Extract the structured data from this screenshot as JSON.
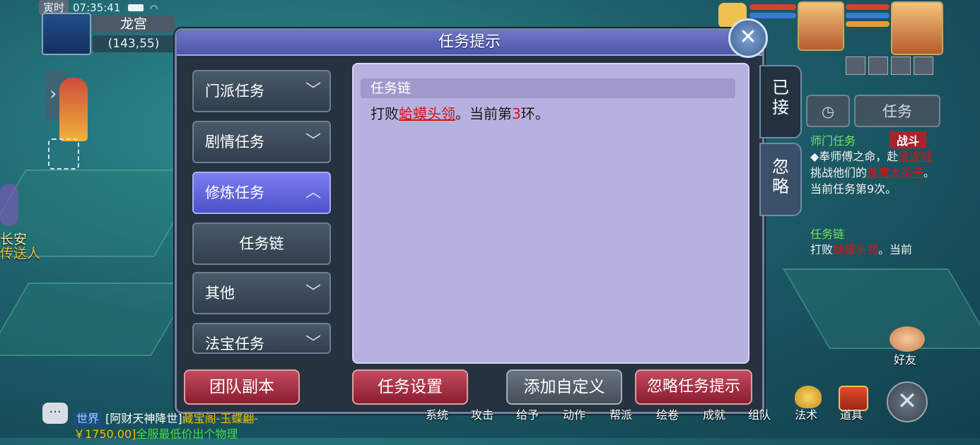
{
  "status": {
    "tag": "寅时",
    "time": "07:35:41"
  },
  "map": {
    "name": "龙宫",
    "coords": "(143,55)"
  },
  "left_npcs": [
    {
      "label": "长安"
    },
    {
      "label": "传送人"
    }
  ],
  "dialog": {
    "title": "任务提示",
    "categories": [
      {
        "label": "门派任务",
        "expanded": false
      },
      {
        "label": "剧情任务",
        "expanded": false
      },
      {
        "label": "修炼任务",
        "expanded": true,
        "active": true
      },
      {
        "label": "任务链",
        "sub": true
      },
      {
        "label": "其他",
        "expanded": false
      },
      {
        "label": "法宝任务",
        "expanded": false
      }
    ],
    "detail": {
      "header": "任务链",
      "prefix": "打败",
      "target": "蛤蟆头领",
      "middle": "。当前第",
      "count": "3",
      "suffix": "环。"
    },
    "tabs": [
      {
        "label": "已接",
        "active": true
      },
      {
        "label": "忽略",
        "active": false
      }
    ],
    "buttons": {
      "team_dungeon": "团队副本",
      "task_settings": "任务设置",
      "add_custom": "添加自定义",
      "ignore_tips": "忽略任务提示"
    }
  },
  "tracker": {
    "tab_label": "任务",
    "item1": {
      "title": "师门任务",
      "tag": "战斗",
      "line1": "◆奉师傅之命，赴",
      "link1": "凌波城",
      "line2": "挑战他们的",
      "link2": "首席大弟子",
      "line3": "。当前任务第9次。"
    },
    "item2": {
      "title": "任务链",
      "prefix": "打败",
      "link": "蛤蟆头领",
      "suffix": "。当前"
    }
  },
  "chat": {
    "channel": "世界",
    "sender": "[阿财天神降世]",
    "msg1": "藏宝阁-玉蝶翩-￥1750.00]",
    "msg2": "全服最低价出个物理"
  },
  "bottom_menu": [
    "系统",
    "攻击",
    "给予",
    "动作",
    "帮派",
    "绘卷",
    "成就",
    "组队",
    "法术",
    "道具"
  ],
  "friends_label": "好友"
}
